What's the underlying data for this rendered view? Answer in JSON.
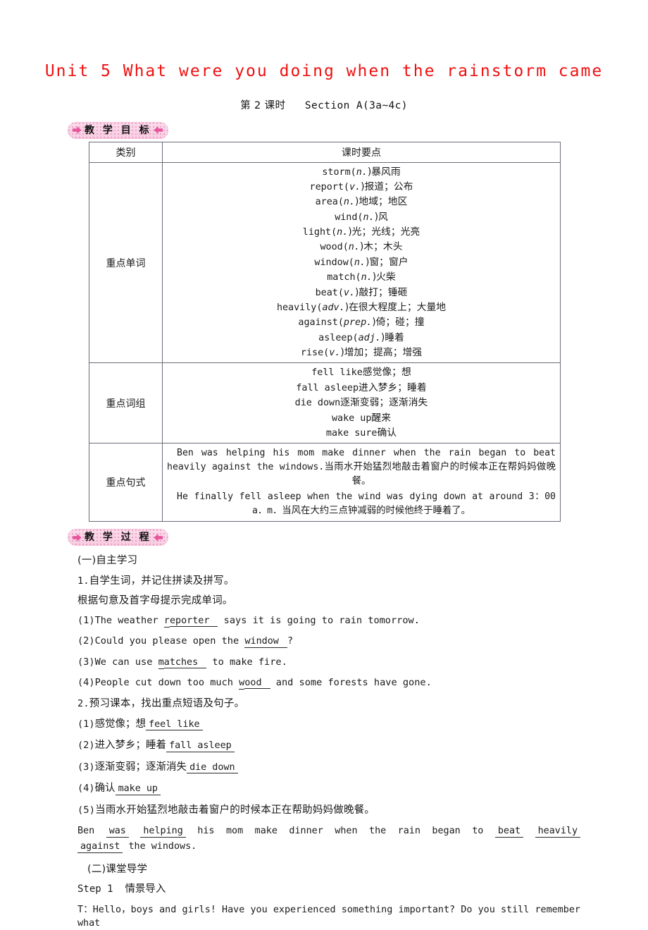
{
  "document": {
    "title": "Unit 5 What were you doing when the rainstorm came",
    "subtitle_period": "第 2 课时",
    "subtitle_section": "Section A(3a~4c)",
    "title_color": "#ee1111"
  },
  "banners": {
    "objectives": "教 学 目 标",
    "process": "教 学 过 程"
  },
  "table": {
    "headers": [
      "类别",
      "课时要点"
    ],
    "rows": [
      {
        "category": "重点单词",
        "lines": [
          {
            "word": "storm",
            "pos": "n.",
            "meaning": "暴风雨"
          },
          {
            "word": "report",
            "pos": "v.",
            "meaning": "报道；公布"
          },
          {
            "word": "area",
            "pos": "n.",
            "meaning": "地域；地区"
          },
          {
            "word": "wind",
            "pos": "n.",
            "meaning": "风"
          },
          {
            "word": "light",
            "pos": "n.",
            "meaning": "光；光线；光亮"
          },
          {
            "word": "wood",
            "pos": "n.",
            "meaning": "木；木头"
          },
          {
            "word": "window",
            "pos": "n.",
            "meaning": "窗；窗户"
          },
          {
            "word": "match",
            "pos": "n.",
            "meaning": "火柴"
          },
          {
            "word": "beat",
            "pos": "v.",
            "meaning": "敲打；锤砸"
          },
          {
            "word": "heavily",
            "pos": "adv.",
            "meaning": "在很大程度上；大量地"
          },
          {
            "word": "against",
            "pos": "prep.",
            "meaning": "倚；碰；撞"
          },
          {
            "word": "asleep",
            "pos": "adj.",
            "meaning": "睡着"
          },
          {
            "word": "rise",
            "pos": "v.",
            "meaning": "增加；提高；增强"
          }
        ]
      },
      {
        "category": "重点词组",
        "lines": [
          {
            "phrase": "fell like",
            "meaning": "感觉像；想"
          },
          {
            "phrase": "fall asleep",
            "meaning": "进入梦乡；睡着"
          },
          {
            "phrase": "die down",
            "meaning": "逐渐变弱；逐渐消失"
          },
          {
            "phrase": "wake up",
            "meaning": "醒来"
          },
          {
            "phrase": "make sure",
            "meaning": "确认"
          }
        ]
      },
      {
        "category": "重点句式",
        "sentences": [
          {
            "en": "Ben was helping his mom make dinner when the rain began to beat heavily against the windows.",
            "cn": "当雨水开始猛烈地敲击着窗户的时候本正在帮妈妈做晚餐。"
          },
          {
            "en": "He finally fell asleep when the wind was dying down at around 3：00 a．m．",
            "cn": "当风在大约三点钟减弱的时候他终于睡着了。"
          }
        ]
      }
    ]
  },
  "process": {
    "part_one_heading": "(一)自主学习",
    "task1_number": "1.",
    "task1_text": "自学生词，并记住拼读及拼写。",
    "task1_instruction": "根据句意及首字母提示完成单词。",
    "task1_items": [
      {
        "num": "(1)",
        "before": "The weather ",
        "lead": "r",
        "answer": "eporter",
        "after": " says it is going to rain tomorrow."
      },
      {
        "num": "(2)",
        "before": "Could you please open the ",
        "lead": "w",
        "answer": "indow",
        "after": "?"
      },
      {
        "num": "(3)",
        "before": "We can use ",
        "lead": "m",
        "answer": "atches",
        "after": " to make fire."
      },
      {
        "num": "(4)",
        "before": "People cut down too much ",
        "lead": "w",
        "answer": "ood",
        "after": " and some forests have gone."
      }
    ],
    "task2_number": "2.",
    "task2_text": "预习课本，找出重点短语及句子。",
    "task2_items": [
      {
        "num": "(1)",
        "cn": "感觉像；想",
        "answer": "feel  like"
      },
      {
        "num": "(2)",
        "cn": "进入梦乡；睡着",
        "answer": "fall  asleep"
      },
      {
        "num": "(3)",
        "cn": "逐渐变弱；逐渐消失",
        "answer": "die  down"
      },
      {
        "num": "(4)",
        "cn": "确认",
        "answer": "make  up"
      }
    ],
    "task2_sentence_num": "(5)",
    "task2_sentence_cn": "当雨水开始猛烈地敲击着窗户的时候本正在帮助妈妈做晚餐。",
    "fill_sentence": {
      "seg1": "Ben",
      "blank1": "was",
      "blank2": "helping",
      "seg2": "his mom make dinner when the rain began to",
      "blank3": "beat",
      "blank4": "heavily",
      "blank5": "against",
      "seg3": "the windows."
    },
    "part_two_heading": "(二)课堂导学",
    "step1_label": "Step 1",
    "step1_title": "情景导入",
    "step1_text": "T：Hello，boys and girls! Have you experienced something important? Do you still remember what"
  }
}
